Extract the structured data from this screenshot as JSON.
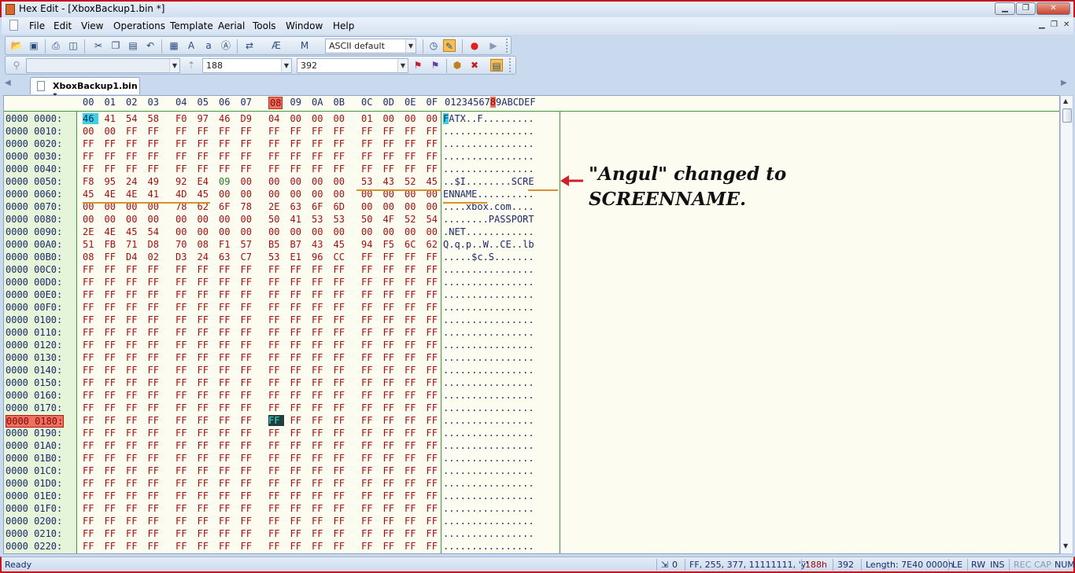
{
  "window": {
    "title": "Hex Edit - [XboxBackup1.bin *]",
    "controls": {
      "minimize": "▁",
      "maximize": "❐",
      "close": "✕"
    }
  },
  "menu": {
    "items": [
      "File",
      "Edit",
      "View",
      "Operations",
      "Template",
      "Aerial",
      "Tools",
      "Window",
      "Help"
    ],
    "mdi_controls": [
      "▁",
      "❐",
      "✕"
    ]
  },
  "toolbar1": {
    "charset_combo": "ASCII default"
  },
  "toolbar2": {
    "find_combo": "",
    "offset_combo": "188",
    "decimal_combo": "392"
  },
  "tabs": {
    "active": "XboxBackup1.bin *"
  },
  "hex": {
    "col_headers": [
      "00",
      "01",
      "02",
      "03",
      "04",
      "05",
      "06",
      "07",
      "08",
      "09",
      "0A",
      "0B",
      "0C",
      "0D",
      "0E",
      "0F"
    ],
    "highlight_col": "08",
    "ascii_header_pre": "01234567",
    "ascii_header_hl": "8",
    "ascii_header_post": "9ABCDEF",
    "rows": [
      {
        "addr": "0000 0000:",
        "bytes": [
          "46",
          "41",
          "54",
          "58",
          "F0",
          "97",
          "46",
          "D9",
          "04",
          "00",
          "00",
          "00",
          "01",
          "00",
          "00",
          "00"
        ],
        "ascii_cur": "F",
        "ascii": "ATX..F........."
      },
      {
        "addr": "0000 0010:",
        "bytes": [
          "00",
          "00",
          "FF",
          "FF",
          "FF",
          "FF",
          "FF",
          "FF",
          "FF",
          "FF",
          "FF",
          "FF",
          "FF",
          "FF",
          "FF",
          "FF"
        ],
        "ascii": "................"
      },
      {
        "addr": "0000 0020:",
        "bytes": [
          "FF",
          "FF",
          "FF",
          "FF",
          "FF",
          "FF",
          "FF",
          "FF",
          "FF",
          "FF",
          "FF",
          "FF",
          "FF",
          "FF",
          "FF",
          "FF"
        ],
        "ascii": "................"
      },
      {
        "addr": "0000 0030:",
        "bytes": [
          "FF",
          "FF",
          "FF",
          "FF",
          "FF",
          "FF",
          "FF",
          "FF",
          "FF",
          "FF",
          "FF",
          "FF",
          "FF",
          "FF",
          "FF",
          "FF"
        ],
        "ascii": "................"
      },
      {
        "addr": "0000 0040:",
        "bytes": [
          "FF",
          "FF",
          "FF",
          "FF",
          "FF",
          "FF",
          "FF",
          "FF",
          "FF",
          "FF",
          "FF",
          "FF",
          "FF",
          "FF",
          "FF",
          "FF"
        ],
        "ascii": "................"
      },
      {
        "addr": "0000 0050:",
        "bytes": [
          "F8",
          "95",
          "24",
          "49",
          "92",
          "E4",
          "09",
          "00",
          "00",
          "00",
          "00",
          "00",
          "53",
          "43",
          "52",
          "45"
        ],
        "ascii": "..$I........SCRE"
      },
      {
        "addr": "0000 0060:",
        "bytes": [
          "45",
          "4E",
          "4E",
          "41",
          "4D",
          "45",
          "00",
          "00",
          "00",
          "00",
          "00",
          "00",
          "00",
          "00",
          "00",
          "00"
        ],
        "ascii": "ENNAME.........."
      },
      {
        "addr": "0000 0070:",
        "bytes": [
          "00",
          "00",
          "00",
          "00",
          "78",
          "62",
          "6F",
          "78",
          "2E",
          "63",
          "6F",
          "6D",
          "00",
          "00",
          "00",
          "00"
        ],
        "ascii": "....xbox.com...."
      },
      {
        "addr": "0000 0080:",
        "bytes": [
          "00",
          "00",
          "00",
          "00",
          "00",
          "00",
          "00",
          "00",
          "50",
          "41",
          "53",
          "53",
          "50",
          "4F",
          "52",
          "54"
        ],
        "ascii": "........PASSPORT"
      },
      {
        "addr": "0000 0090:",
        "bytes": [
          "2E",
          "4E",
          "45",
          "54",
          "00",
          "00",
          "00",
          "00",
          "00",
          "00",
          "00",
          "00",
          "00",
          "00",
          "00",
          "00"
        ],
        "ascii": ".NET............"
      },
      {
        "addr": "0000 00A0:",
        "bytes": [
          "51",
          "FB",
          "71",
          "D8",
          "70",
          "08",
          "F1",
          "57",
          "B5",
          "B7",
          "43",
          "45",
          "94",
          "F5",
          "6C",
          "62"
        ],
        "ascii": "Q.q.p..W..CE..lb"
      },
      {
        "addr": "0000 00B0:",
        "bytes": [
          "08",
          "FF",
          "D4",
          "02",
          "D3",
          "24",
          "63",
          "C7",
          "53",
          "E1",
          "96",
          "CC",
          "FF",
          "FF",
          "FF",
          "FF"
        ],
        "ascii": ".....$c.S......."
      },
      {
        "addr": "0000 00C0:",
        "bytes": [
          "FF",
          "FF",
          "FF",
          "FF",
          "FF",
          "FF",
          "FF",
          "FF",
          "FF",
          "FF",
          "FF",
          "FF",
          "FF",
          "FF",
          "FF",
          "FF"
        ],
        "ascii": "................"
      },
      {
        "addr": "0000 00D0:",
        "bytes": [
          "FF",
          "FF",
          "FF",
          "FF",
          "FF",
          "FF",
          "FF",
          "FF",
          "FF",
          "FF",
          "FF",
          "FF",
          "FF",
          "FF",
          "FF",
          "FF"
        ],
        "ascii": "................"
      },
      {
        "addr": "0000 00E0:",
        "bytes": [
          "FF",
          "FF",
          "FF",
          "FF",
          "FF",
          "FF",
          "FF",
          "FF",
          "FF",
          "FF",
          "FF",
          "FF",
          "FF",
          "FF",
          "FF",
          "FF"
        ],
        "ascii": "................"
      },
      {
        "addr": "0000 00F0:",
        "bytes": [
          "FF",
          "FF",
          "FF",
          "FF",
          "FF",
          "FF",
          "FF",
          "FF",
          "FF",
          "FF",
          "FF",
          "FF",
          "FF",
          "FF",
          "FF",
          "FF"
        ],
        "ascii": "................"
      },
      {
        "addr": "0000 0100:",
        "bytes": [
          "FF",
          "FF",
          "FF",
          "FF",
          "FF",
          "FF",
          "FF",
          "FF",
          "FF",
          "FF",
          "FF",
          "FF",
          "FF",
          "FF",
          "FF",
          "FF"
        ],
        "ascii": "................"
      },
      {
        "addr": "0000 0110:",
        "bytes": [
          "FF",
          "FF",
          "FF",
          "FF",
          "FF",
          "FF",
          "FF",
          "FF",
          "FF",
          "FF",
          "FF",
          "FF",
          "FF",
          "FF",
          "FF",
          "FF"
        ],
        "ascii": "................"
      },
      {
        "addr": "0000 0120:",
        "bytes": [
          "FF",
          "FF",
          "FF",
          "FF",
          "FF",
          "FF",
          "FF",
          "FF",
          "FF",
          "FF",
          "FF",
          "FF",
          "FF",
          "FF",
          "FF",
          "FF"
        ],
        "ascii": "................"
      },
      {
        "addr": "0000 0130:",
        "bytes": [
          "FF",
          "FF",
          "FF",
          "FF",
          "FF",
          "FF",
          "FF",
          "FF",
          "FF",
          "FF",
          "FF",
          "FF",
          "FF",
          "FF",
          "FF",
          "FF"
        ],
        "ascii": "................"
      },
      {
        "addr": "0000 0140:",
        "bytes": [
          "FF",
          "FF",
          "FF",
          "FF",
          "FF",
          "FF",
          "FF",
          "FF",
          "FF",
          "FF",
          "FF",
          "FF",
          "FF",
          "FF",
          "FF",
          "FF"
        ],
        "ascii": "................"
      },
      {
        "addr": "0000 0150:",
        "bytes": [
          "FF",
          "FF",
          "FF",
          "FF",
          "FF",
          "FF",
          "FF",
          "FF",
          "FF",
          "FF",
          "FF",
          "FF",
          "FF",
          "FF",
          "FF",
          "FF"
        ],
        "ascii": "................"
      },
      {
        "addr": "0000 0160:",
        "bytes": [
          "FF",
          "FF",
          "FF",
          "FF",
          "FF",
          "FF",
          "FF",
          "FF",
          "FF",
          "FF",
          "FF",
          "FF",
          "FF",
          "FF",
          "FF",
          "FF"
        ],
        "ascii": "................"
      },
      {
        "addr": "0000 0170:",
        "bytes": [
          "FF",
          "FF",
          "FF",
          "FF",
          "FF",
          "FF",
          "FF",
          "FF",
          "FF",
          "FF",
          "FF",
          "FF",
          "FF",
          "FF",
          "FF",
          "FF"
        ],
        "ascii": "................"
      },
      {
        "addr": "0000 0180:",
        "bytes": [
          "FF",
          "FF",
          "FF",
          "FF",
          "FF",
          "FF",
          "FF",
          "FF",
          "FF",
          "FF",
          "FF",
          "FF",
          "FF",
          "FF",
          "FF",
          "FF"
        ],
        "ascii": "................",
        "selected_col": 8,
        "addr_highlight": true
      },
      {
        "addr": "0000 0190:",
        "bytes": [
          "FF",
          "FF",
          "FF",
          "FF",
          "FF",
          "FF",
          "FF",
          "FF",
          "FF",
          "FF",
          "FF",
          "FF",
          "FF",
          "FF",
          "FF",
          "FF"
        ],
        "ascii": "................"
      },
      {
        "addr": "0000 01A0:",
        "bytes": [
          "FF",
          "FF",
          "FF",
          "FF",
          "FF",
          "FF",
          "FF",
          "FF",
          "FF",
          "FF",
          "FF",
          "FF",
          "FF",
          "FF",
          "FF",
          "FF"
        ],
        "ascii": "................"
      },
      {
        "addr": "0000 01B0:",
        "bytes": [
          "FF",
          "FF",
          "FF",
          "FF",
          "FF",
          "FF",
          "FF",
          "FF",
          "FF",
          "FF",
          "FF",
          "FF",
          "FF",
          "FF",
          "FF",
          "FF"
        ],
        "ascii": "................"
      },
      {
        "addr": "0000 01C0:",
        "bytes": [
          "FF",
          "FF",
          "FF",
          "FF",
          "FF",
          "FF",
          "FF",
          "FF",
          "FF",
          "FF",
          "FF",
          "FF",
          "FF",
          "FF",
          "FF",
          "FF"
        ],
        "ascii": "................"
      },
      {
        "addr": "0000 01D0:",
        "bytes": [
          "FF",
          "FF",
          "FF",
          "FF",
          "FF",
          "FF",
          "FF",
          "FF",
          "FF",
          "FF",
          "FF",
          "FF",
          "FF",
          "FF",
          "FF",
          "FF"
        ],
        "ascii": "................"
      },
      {
        "addr": "0000 01E0:",
        "bytes": [
          "FF",
          "FF",
          "FF",
          "FF",
          "FF",
          "FF",
          "FF",
          "FF",
          "FF",
          "FF",
          "FF",
          "FF",
          "FF",
          "FF",
          "FF",
          "FF"
        ],
        "ascii": "................"
      },
      {
        "addr": "0000 01F0:",
        "bytes": [
          "FF",
          "FF",
          "FF",
          "FF",
          "FF",
          "FF",
          "FF",
          "FF",
          "FF",
          "FF",
          "FF",
          "FF",
          "FF",
          "FF",
          "FF",
          "FF"
        ],
        "ascii": "................"
      },
      {
        "addr": "0000 0200:",
        "bytes": [
          "FF",
          "FF",
          "FF",
          "FF",
          "FF",
          "FF",
          "FF",
          "FF",
          "FF",
          "FF",
          "FF",
          "FF",
          "FF",
          "FF",
          "FF",
          "FF"
        ],
        "ascii": "................"
      },
      {
        "addr": "0000 0210:",
        "bytes": [
          "FF",
          "FF",
          "FF",
          "FF",
          "FF",
          "FF",
          "FF",
          "FF",
          "FF",
          "FF",
          "FF",
          "FF",
          "FF",
          "FF",
          "FF",
          "FF"
        ],
        "ascii": "................"
      },
      {
        "addr": "0000 0220:",
        "bytes": [
          "FF",
          "FF",
          "FF",
          "FF",
          "FF",
          "FF",
          "FF",
          "FF",
          "FF",
          "FF",
          "FF",
          "FF",
          "FF",
          "FF",
          "FF",
          "FF"
        ],
        "ascii": "................"
      }
    ]
  },
  "annotation": {
    "line1": "\"Angul\" changed to",
    "line2": "SCREENNAME.",
    "arrow_color": "#d0202a"
  },
  "status": {
    "ready": "Ready",
    "sel_count": "0",
    "char_info": "FF, 255, 377, 11111111, 'ÿ'",
    "hex_offset": "188h",
    "dec_offset": "392",
    "length": "Length: 7E40 0000h",
    "endian": "LE",
    "rw": "RW",
    "ins": "INS",
    "rec": "REC",
    "cap": "CAP",
    "num": "NUM"
  },
  "colors": {
    "accent_red": "#c8141c",
    "hex_text": "#a01010",
    "cursor": "#3ed0e0",
    "highlight": "#ef7060"
  }
}
